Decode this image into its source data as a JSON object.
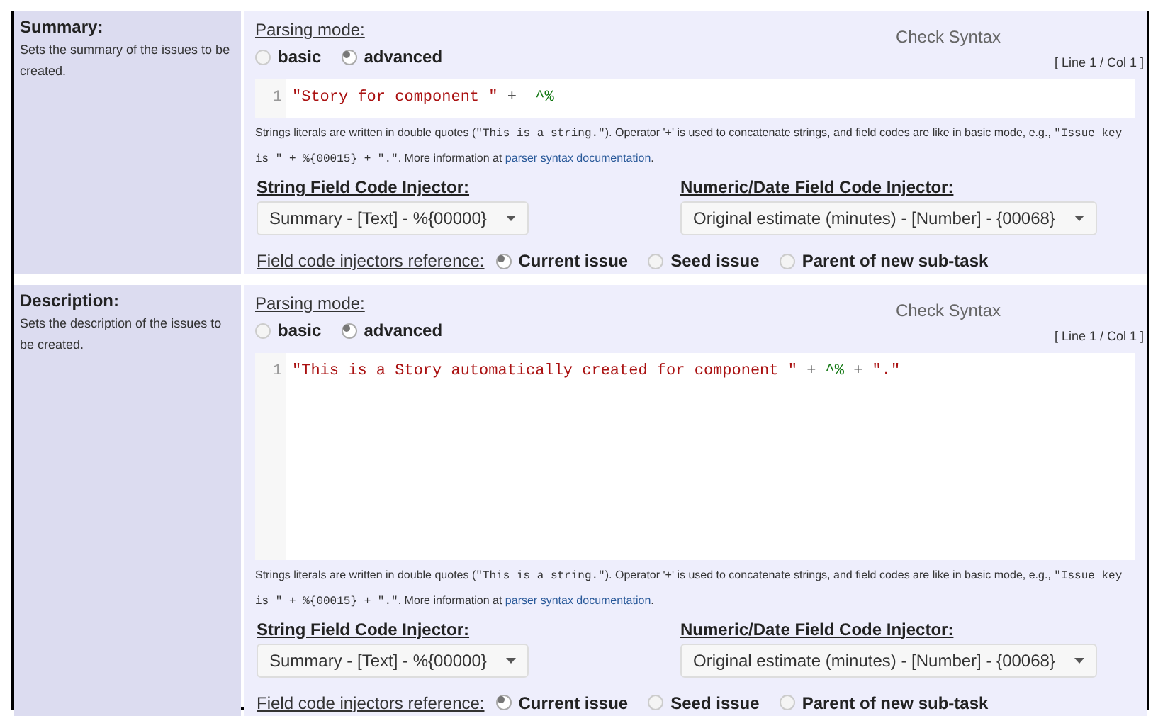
{
  "sections": [
    {
      "label": "Summary:",
      "description": "Sets the summary of the issues to be created.",
      "parsing_mode": {
        "label": "Parsing mode:",
        "options": [
          {
            "label": "basic",
            "selected": false
          },
          {
            "label": "advanced",
            "selected": true
          }
        ]
      },
      "check_syntax": "Check Syntax",
      "cursor_position": "[ Line 1 / Col 1 ]",
      "editor": {
        "line_number": "1",
        "tokens": [
          {
            "kind": "string",
            "text": "\"Story for component \""
          },
          {
            "kind": "operator",
            "text": " +  "
          },
          {
            "kind": "fieldcode",
            "text": "^%"
          }
        ]
      },
      "help": [
        {
          "kind": "text",
          "text": "Strings literals are written in double quotes ("
        },
        {
          "kind": "code",
          "text": "\"This is a string.\""
        },
        {
          "kind": "text",
          "text": "). Operator '+' is used to concatenate strings, and field codes are like in basic mode, e.g., "
        },
        {
          "kind": "code",
          "text": "\"Issue key is \" + %{00015} + \".\""
        },
        {
          "kind": "text",
          "text": ". More information at "
        },
        {
          "kind": "link",
          "text": "parser syntax documentation"
        },
        {
          "kind": "text",
          "text": "."
        }
      ],
      "string_injector": {
        "label": "String Field Code Injector:",
        "value": "Summary - [Text] - %{00000}"
      },
      "numeric_injector": {
        "label": "Numeric/Date Field Code Injector:",
        "value": "Original estimate (minutes) - [Number] - {00068}"
      },
      "reference": {
        "label": "Field code injectors reference:",
        "options": [
          {
            "label": "Current issue",
            "selected": true
          },
          {
            "label": "Seed issue",
            "selected": false
          },
          {
            "label": "Parent of new sub-task",
            "selected": false
          }
        ]
      }
    },
    {
      "label": "Description:",
      "description": "Sets the description of the issues to be created.",
      "parsing_mode": {
        "label": "Parsing mode:",
        "options": [
          {
            "label": "basic",
            "selected": false
          },
          {
            "label": "advanced",
            "selected": true
          }
        ]
      },
      "check_syntax": "Check Syntax",
      "cursor_position": "[ Line 1 / Col 1 ]",
      "editor": {
        "line_number": "1",
        "tokens": [
          {
            "kind": "string",
            "text": "\"This is a Story automatically created for component \""
          },
          {
            "kind": "operator",
            "text": " + "
          },
          {
            "kind": "fieldcode",
            "text": "^%"
          },
          {
            "kind": "operator",
            "text": " + "
          },
          {
            "kind": "string",
            "text": "\".\""
          }
        ]
      },
      "help": [
        {
          "kind": "text",
          "text": "Strings literals are written in double quotes ("
        },
        {
          "kind": "code",
          "text": "\"This is a string.\""
        },
        {
          "kind": "text",
          "text": "). Operator '+' is used to concatenate strings, and field codes are like in basic mode, e.g., "
        },
        {
          "kind": "code",
          "text": "\"Issue key is \" + %{00015} + \".\""
        },
        {
          "kind": "text",
          "text": ". More information at "
        },
        {
          "kind": "link",
          "text": "parser syntax documentation"
        },
        {
          "kind": "text",
          "text": "."
        }
      ],
      "string_injector": {
        "label": "String Field Code Injector:",
        "value": "Summary - [Text] - %{00000}"
      },
      "numeric_injector": {
        "label": "Numeric/Date Field Code Injector:",
        "value": "Original estimate (minutes) - [Number] - {00068}"
      },
      "reference": {
        "label": "Field code injectors reference:",
        "options": [
          {
            "label": "Current issue",
            "selected": true
          },
          {
            "label": "Seed issue",
            "selected": false
          },
          {
            "label": "Parent of new sub-task",
            "selected": false
          }
        ]
      }
    }
  ]
}
